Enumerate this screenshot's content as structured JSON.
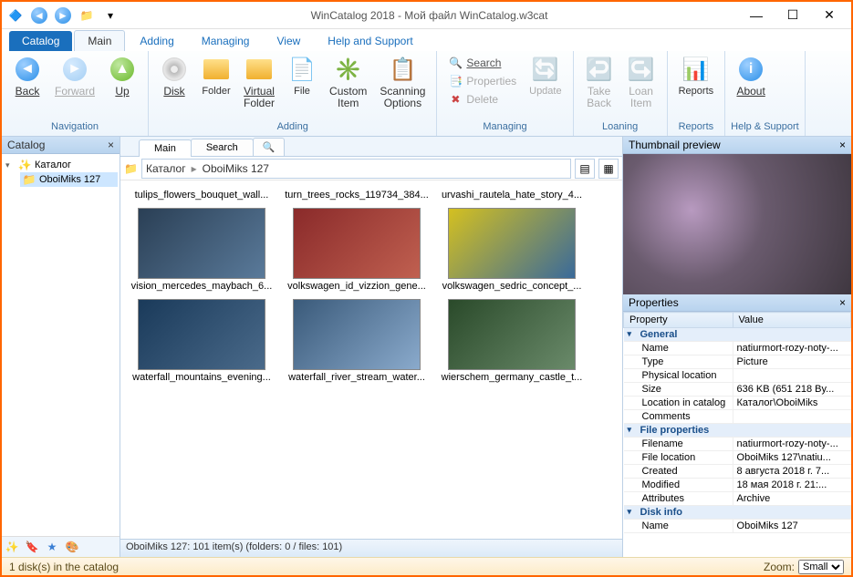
{
  "title": "WinCatalog 2018 - Мой файл WinCatalog.w3cat",
  "menutabs": {
    "catalog": "Catalog",
    "main": "Main",
    "adding": "Adding",
    "managing": "Managing",
    "view": "View",
    "help": "Help and Support"
  },
  "ribbon": {
    "nav": {
      "back": "Back",
      "forward": "Forward",
      "up": "Up",
      "group": "Navigation"
    },
    "adding": {
      "disk": "Disk",
      "folder": "Folder",
      "vfolder_l1": "Virtual",
      "vfolder_l2": "Folder",
      "file": "File",
      "custom_l1": "Custom",
      "custom_l2": "Item",
      "scan_l1": "Scanning",
      "scan_l2": "Options",
      "group": "Adding"
    },
    "managing": {
      "search": "Search",
      "properties": "Properties",
      "delete": "Delete",
      "update": "Update",
      "group": "Managing"
    },
    "loaning": {
      "take_l1": "Take",
      "take_l2": "Back",
      "loan_l1": "Loan",
      "loan_l2": "Item",
      "group": "Loaning"
    },
    "reports": {
      "btn": "Reports",
      "group": "Reports"
    },
    "help": {
      "about": "About",
      "group": "Help & Support"
    }
  },
  "catalog_panel": {
    "title": "Catalog",
    "root": "Каталог",
    "child": "OboiMiks 127"
  },
  "center": {
    "tabs": {
      "main": "Main",
      "search": "Search"
    },
    "crumb1": "Каталог",
    "crumb2": "OboiMiks 127",
    "thumbs": [
      "tulips_flowers_bouquet_wall...",
      "turn_trees_rocks_119734_384...",
      "urvashi_rautela_hate_story_4...",
      "vision_mercedes_maybach_6...",
      "volkswagen_id_vizzion_gene...",
      "volkswagen_sedric_concept_...",
      "waterfall_mountains_evening...",
      "waterfall_river_stream_water...",
      "wierschem_germany_castle_t..."
    ],
    "info": "OboiMiks 127: 101 item(s) (folders: 0 / files: 101)"
  },
  "right": {
    "preview_title": "Thumbnail preview",
    "props_title": "Properties",
    "col_property": "Property",
    "col_value": "Value",
    "groups": {
      "general": "General",
      "fileprops": "File properties",
      "diskinfo": "Disk info"
    },
    "rows": {
      "name_k": "Name",
      "name_v": "natiurmort-rozy-noty-...",
      "type_k": "Type",
      "type_v": "Picture",
      "ploc_k": "Physical location",
      "ploc_v": "",
      "size_k": "Size",
      "size_v": "636 KB (651 218 By...",
      "loc_k": "Location in catalog",
      "loc_v": "Каталог\\OboiMiks",
      "comm_k": "Comments",
      "comm_v": "",
      "fname_k": "Filename",
      "fname_v": "natiurmort-rozy-noty-...",
      "floc_k": "File location",
      "floc_v": "OboiMiks 127\\natiu...",
      "created_k": "Created",
      "created_v": "8 августа 2018 г. 7...",
      "mod_k": "Modified",
      "mod_v": "18 мая 2018 г. 21:...",
      "attr_k": "Attributes",
      "attr_v": "Archive",
      "dname_k": "Name",
      "dname_v": "OboiMiks 127"
    }
  },
  "status": {
    "left": "1 disk(s) in the catalog",
    "zoom_label": "Zoom:",
    "zoom_value": "Small"
  }
}
